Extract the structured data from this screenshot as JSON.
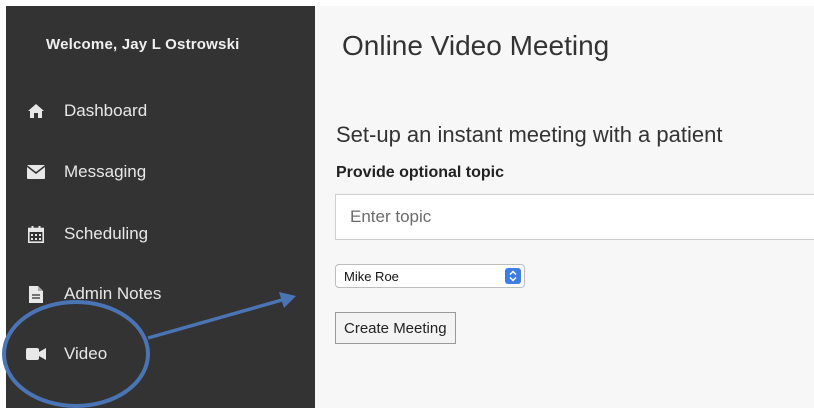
{
  "sidebar": {
    "welcome": "Welcome, Jay L Ostrowski",
    "items": [
      {
        "label": "Dashboard",
        "icon": "home-icon"
      },
      {
        "label": "Messaging",
        "icon": "envelope-icon"
      },
      {
        "label": "Scheduling",
        "icon": "calendar-icon"
      },
      {
        "label": "Admin Notes",
        "icon": "document-icon"
      },
      {
        "label": "Video",
        "icon": "video-camera-icon"
      }
    ]
  },
  "main": {
    "title": "Online Video Meeting",
    "subheading": "Set-up an instant meeting with a patient",
    "topic_label": "Provide optional topic",
    "topic_placeholder": "Enter topic",
    "topic_value": "",
    "patient_selected": "Mike Roe",
    "create_button": "Create Meeting"
  },
  "annotation": {
    "color": "#4a74b4",
    "highlight_target": "Video"
  },
  "colors": {
    "sidebar_bg": "#333333",
    "main_bg": "#f7f7f7",
    "select_accent": "#3d7de5"
  }
}
